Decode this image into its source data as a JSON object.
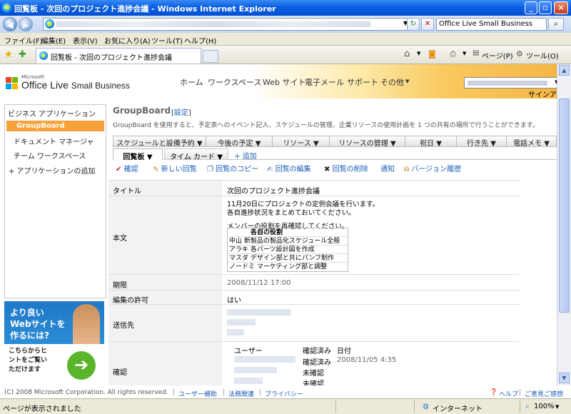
{
  "window": {
    "title": "回覧板 - 次回のプロジェクト進捗会議 - Windows Internet Explorer",
    "search_text": "Office Live Small Business"
  },
  "menu": [
    "ファイル(F)",
    "編集(E)",
    "表示(V)",
    "お気に入り(A)",
    "ツール(T)",
    "ヘルプ(H)"
  ],
  "tab": {
    "label": "回覧板 - 次回のプロジェクト進捗会議"
  },
  "commandbar": {
    "page": "ページ(P)",
    "tools": "ツール(O)"
  },
  "site": {
    "logo_small": "Microsoft",
    "logo_office": "Office Live",
    "logo_sb": "Small Business",
    "nav": [
      "ホーム",
      "ワークスペース",
      "Web サイト",
      "電子メール",
      "サポート",
      "その他"
    ],
    "signout": "サインアウト"
  },
  "sidebar": {
    "header": "ビジネス アプリケーション",
    "items": [
      {
        "label": "GroupBoard"
      },
      {
        "label": "ドキュメント マネージャ"
      },
      {
        "label": "チーム ワークスペース"
      },
      {
        "label": "+ アプリケーションの追加"
      }
    ]
  },
  "ad": {
    "line1": "より良い",
    "line2": "Webサイトを",
    "line3": "作るには?",
    "line4": "こちらからヒ",
    "line5": "ントをご覧い",
    "line6": "ただけます"
  },
  "groupboard": {
    "title": "GroupBoard",
    "settings_open": "[",
    "settings": "設定",
    "settings_close": "]",
    "description": "GroupBoard を使用すると、予定表へのイベント記入、スケジュールの管理、企業リソースの使用計画を 1 つの共有の場所で行うことができます。"
  },
  "tabs_row1": [
    "スケジュールと設備予約",
    "今後の予定",
    "リソース",
    "リソースの管理",
    "祝日",
    "行き先",
    "電話メモ"
  ],
  "tabs_row2": {
    "active": "回覧板",
    "second": "タイム カード",
    "add": "+ 追加"
  },
  "toolbar": [
    "確認",
    "新しい回覧",
    "回覧のコピー",
    "回覧の編集",
    "回覧の削除",
    "通知",
    "バージョン履歴"
  ],
  "form": {
    "title_label": "タイトル",
    "title_value": "次回のプロジェクト進捗会議",
    "body_label": "本文",
    "body_line1": "11月20日にプロジェクトの定例会議を行います。",
    "body_line2": "各自進捗状況をまとめておいてください。",
    "body_line3": "メンバーの役割を再確認してください。",
    "roles_header": "各自の役割",
    "roles": [
      "中山 新製品の製品化スケジュール全般",
      "アラキ 各パーツ設計図を作成",
      "マスダ デザイン部と共にパンフ制作",
      "ノードミ マーケティング部と調整"
    ],
    "due_label": "期限",
    "due_value": "2008/11/12 17:00",
    "edit_label": "編集の許可",
    "edit_value": "はい",
    "to_label": "送信先",
    "confirm_label": "確認",
    "confirm_headers": [
      "ユーザー",
      "確認済み",
      "日付"
    ],
    "confirm_rows": [
      {
        "status": "確認済み",
        "date": "2008/11/05 4:35"
      },
      {
        "status": "未確認",
        "date": ""
      },
      {
        "status": "未確認",
        "date": ""
      }
    ]
  },
  "footer": {
    "copyright": "(C) 2008 Microsoft Corporation. All rights reserved.",
    "sep": "|",
    "links": [
      "ユーザー補助",
      "法務関連",
      "プライバシー"
    ],
    "help": "ヘルプ",
    "feedback": "ご意見ご感想"
  },
  "statusbar": {
    "text": "ページが表示されました",
    "zone": "インターネット",
    "zoom": "100%"
  }
}
